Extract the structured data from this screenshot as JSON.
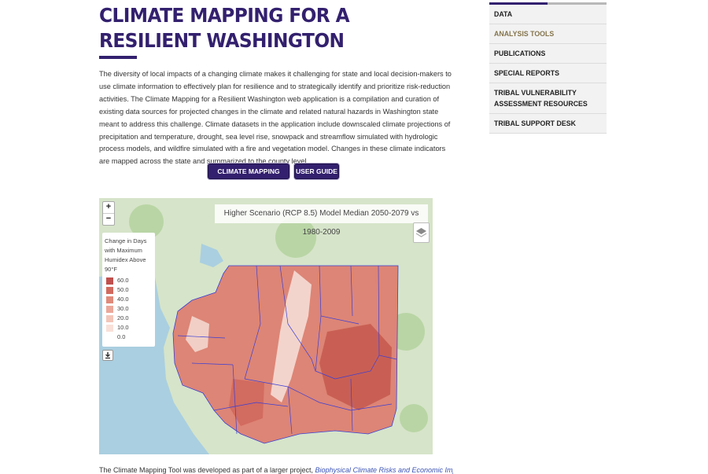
{
  "page": {
    "title": "CLIMATE MAPPING FOR A RESILIENT WASHINGTON",
    "intro": "The diversity of local impacts of a changing climate makes it challenging for state and local decision-makers to use climate information to effectively plan for resilience and to strategically identify and prioritize risk-reduction activities. The Climate Mapping for a Resilient Washington web application is a compilation and curation of existing data sources for projected changes in the climate and related natural hazards in Washington state meant to address this challenge. Climate datasets in the application include downscaled climate projections of precipitation and temperature, drought, sea level rise, snowpack and streamflow simulated with hydrologic process models, and wildfire simulated with a fire and vegetation model. Changes in these climate indicators are mapped across the state and summarized to the county level.",
    "buttons": {
      "tool": "CLIMATE MAPPING TOOL",
      "guide": "USER GUIDE"
    },
    "footer_text": "The Climate Mapping Tool was developed as part of a larger project, ",
    "footer_link": "Biophysical Climate Risks and Economic Impacts for"
  },
  "sidebar": {
    "items": [
      {
        "label": "DATA",
        "active": false
      },
      {
        "label": "ANALYSIS TOOLS",
        "active": true
      },
      {
        "label": "PUBLICATIONS",
        "active": false
      },
      {
        "label": "SPECIAL REPORTS",
        "active": false
      },
      {
        "label": "TRIBAL VULNERABILITY ASSESSMENT RESOURCES",
        "active": false
      },
      {
        "label": "TRIBAL SUPPORT DESK",
        "active": false
      }
    ]
  },
  "map": {
    "title": "Higher Scenario (RCP 8.5) Model Median 2050-2079 vs 1980-2009",
    "zoom_in": "+",
    "zoom_out": "−",
    "legend_title": "Change in Days with Maximum Humidex Above 90°F",
    "legend": [
      {
        "label": "60.0",
        "color": "#c0504d"
      },
      {
        "label": "50.0",
        "color": "#d16a5f"
      },
      {
        "label": "40.0",
        "color": "#e08a7a"
      },
      {
        "label": "30.0",
        "color": "#eba799"
      },
      {
        "label": "20.0",
        "color": "#f3c5b9"
      },
      {
        "label": "10.0",
        "color": "#f9e0d8"
      },
      {
        "label": "0.0",
        "color": "#ffffff"
      }
    ],
    "download_icon": "download-icon",
    "layers_icon": "layers-icon"
  }
}
